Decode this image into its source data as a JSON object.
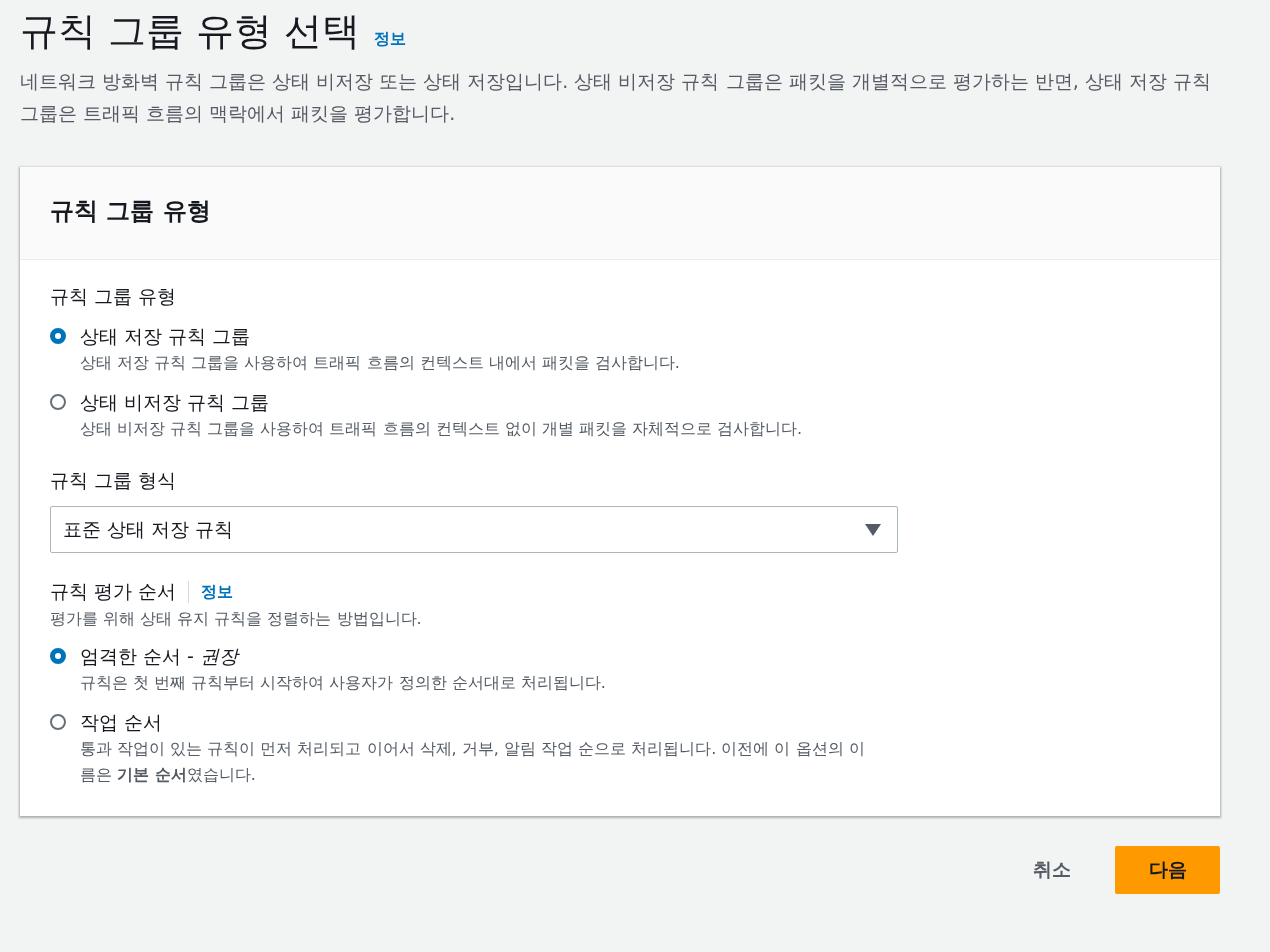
{
  "page": {
    "title": "규칙 그룹 유형 선택",
    "info_link": "정보",
    "description": "네트워크 방화벽 규칙 그룹은 상태 비저장 또는 상태 저장입니다. 상태 비저장 규칙 그룹은 패킷을 개별적으로 평가하는 반면, 상태 저장 규칙 그룹은 트래픽 흐름의 맥락에서 패킷을 평가합니다."
  },
  "card": {
    "header": "규칙 그룹 유형",
    "rule_group_type": {
      "label": "규칙 그룹 유형",
      "options": [
        {
          "label": "상태 저장 규칙 그룹",
          "description": "상태 저장 규칙 그룹을 사용하여 트래픽 흐름의 컨텍스트 내에서 패킷을 검사합니다.",
          "selected": true
        },
        {
          "label": "상태 비저장 규칙 그룹",
          "description": "상태 비저장 규칙 그룹을 사용하여 트래픽 흐름의 컨텍스트 없이 개별 패킷을 자체적으로 검사합니다.",
          "selected": false
        }
      ]
    },
    "rule_group_format": {
      "label": "규칙 그룹 형식",
      "value": "표준 상태 저장 규칙"
    },
    "rule_order": {
      "label": "규칙 평가 순서",
      "info_link": "정보",
      "description": "평가를 위해 상태 유지 규칙을 정렬하는 방법입니다.",
      "options": [
        {
          "label": "엄격한 순서 - *권장*",
          "description": "규칙은 첫 번째 규칙부터 시작하여 사용자가 정의한 순서대로 처리됩니다.",
          "selected": true
        },
        {
          "label": "작업 순서",
          "description": "통과 작업이 있는 규칙이 먼저 처리되고 이어서 삭제, 거부, 알림 작업 순으로 처리됩니다. 이전에 이 옵션의 이름은 **기본 순서**였습니다.",
          "selected": false
        }
      ]
    }
  },
  "buttons": {
    "cancel": "취소",
    "next": "다음"
  }
}
